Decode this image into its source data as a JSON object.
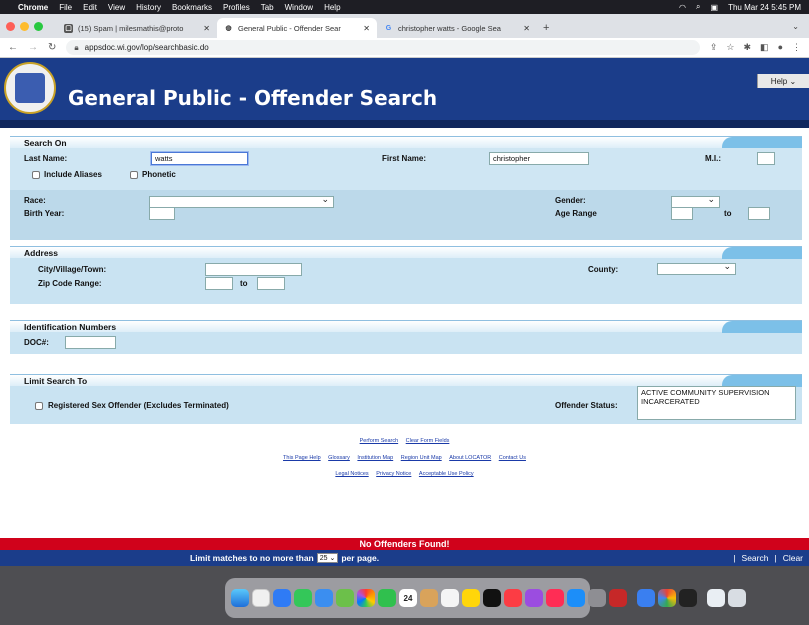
{
  "menubar": {
    "app": "Chrome",
    "items": [
      "File",
      "Edit",
      "View",
      "History",
      "Bookmarks",
      "Profiles",
      "Tab",
      "Window",
      "Help"
    ],
    "clock": "Thu Mar 24  5:45 PM"
  },
  "tabs": [
    {
      "title": "(15) Spam | milesmathis@proto",
      "icon": "mail-icon"
    },
    {
      "title": "General Public - Offender Sear",
      "icon": "globe-icon"
    },
    {
      "title": "christopher watts - Google Sea",
      "icon": "google-icon"
    }
  ],
  "address": {
    "url": "appsdoc.wi.gov/lop/searchbasic.do"
  },
  "page": {
    "title": "General Public - Offender Search",
    "help": "Help ⌄"
  },
  "search_on": {
    "heading": "Search On",
    "last_name_label": "Last Name:",
    "last_name_value": "watts",
    "first_name_label": "First Name:",
    "first_name_value": "christopher",
    "mi_label": "M.I.:",
    "include_aliases_label": "Include Aliases",
    "phonetic_label": "Phonetic",
    "race_label": "Race:",
    "gender_label": "Gender:",
    "birth_year_label": "Birth Year:",
    "age_range_label": "Age Range",
    "to_label": "to"
  },
  "address_section": {
    "heading": "Address",
    "city_label": "City/Village/Town:",
    "county_label": "County:",
    "zip_label": "Zip Code Range:",
    "to_label": "to"
  },
  "id_section": {
    "heading": "Identification Numbers",
    "doc_label": "DOC#:"
  },
  "limit_section": {
    "heading": "Limit Search To",
    "sex_offender_label": "Registered Sex Offender (Excludes Terminated)",
    "status_label": "Offender Status:",
    "status_options": [
      "ACTIVE COMMUNITY SUPERVISION",
      "INCARCERATED"
    ]
  },
  "links": {
    "row1": [
      "Perform Search",
      "Clear Form Fields"
    ],
    "row2": [
      "This Page Help",
      "Glossary",
      "Institution Map",
      "Region Unit Map",
      "About LOCATOR",
      "Contact Us"
    ],
    "row3": [
      "Legal Notices",
      "Privacy Notice",
      "Acceptable Use Policy"
    ]
  },
  "results": {
    "message": "No Offenders Found!",
    "limit_prefix": "Limit matches to no more than",
    "limit_value": "25",
    "limit_suffix": "per page.",
    "search": "Search",
    "clear": "Clear"
  },
  "dock": {
    "calendar_day": "24"
  },
  "colors": {
    "banner": "#1b3d8a",
    "alert": "#d0021b",
    "section": "#c9e3f2"
  }
}
